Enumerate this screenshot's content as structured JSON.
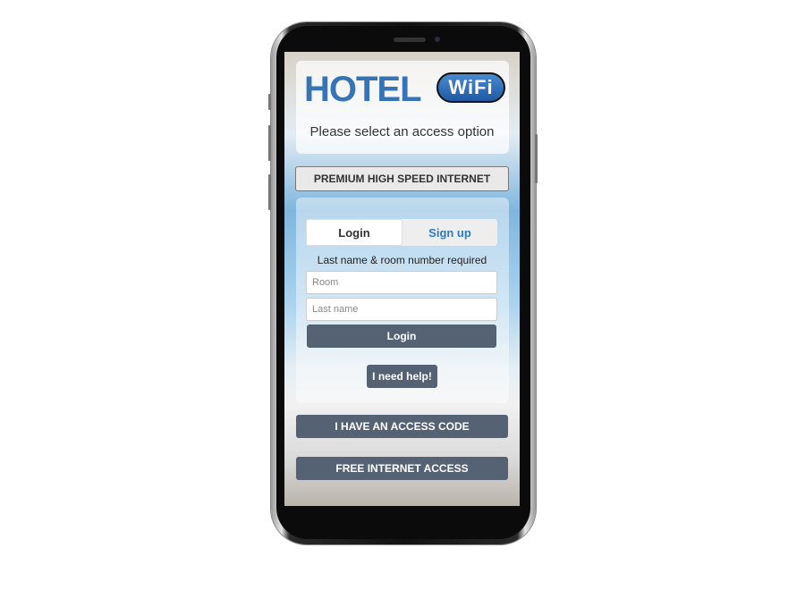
{
  "header": {
    "logo_text": "HOTEL",
    "logo_badge": "WiFi",
    "prompt": "Please select an access option"
  },
  "options": {
    "premium": "PREMIUM HIGH SPEED INTERNET",
    "access_code": "I HAVE AN ACCESS CODE",
    "free": "FREE INTERNET ACCESS"
  },
  "login_panel": {
    "tabs": [
      {
        "label": "Login",
        "active": true
      },
      {
        "label": "Sign up",
        "active": false
      }
    ],
    "hint": "Last name & room number required",
    "room_placeholder": "Room",
    "lastname_placeholder": "Last name",
    "login_button": "Login",
    "help_button": "I need help!"
  },
  "colors": {
    "accent": "#556274",
    "brand_blue": "#3674b6",
    "tab_link": "#2f7ac0"
  }
}
